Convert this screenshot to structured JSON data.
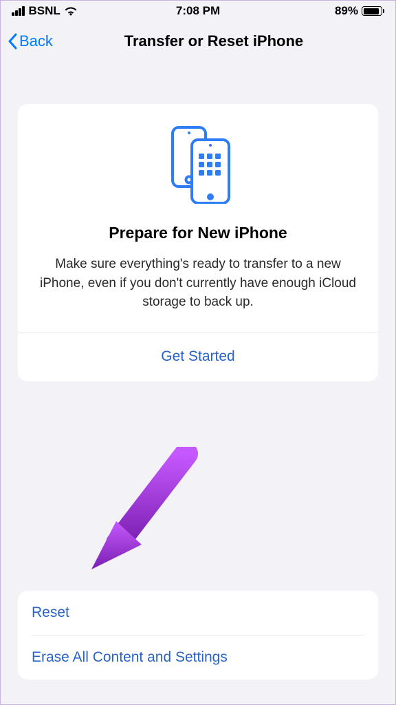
{
  "status": {
    "carrier": "BSNL",
    "time": "7:08 PM",
    "battery_percent": "89%"
  },
  "nav": {
    "back_label": "Back",
    "title": "Transfer or Reset iPhone"
  },
  "prepare_card": {
    "title": "Prepare for New iPhone",
    "description": "Make sure everything's ready to transfer to a new iPhone, even if you don't currently have enough iCloud storage to back up.",
    "action_label": "Get Started"
  },
  "options": {
    "reset_label": "Reset",
    "erase_label": "Erase All Content and Settings"
  },
  "colors": {
    "accent": "#007aff",
    "link": "#2863c9",
    "arrow": "#8e24d1"
  }
}
